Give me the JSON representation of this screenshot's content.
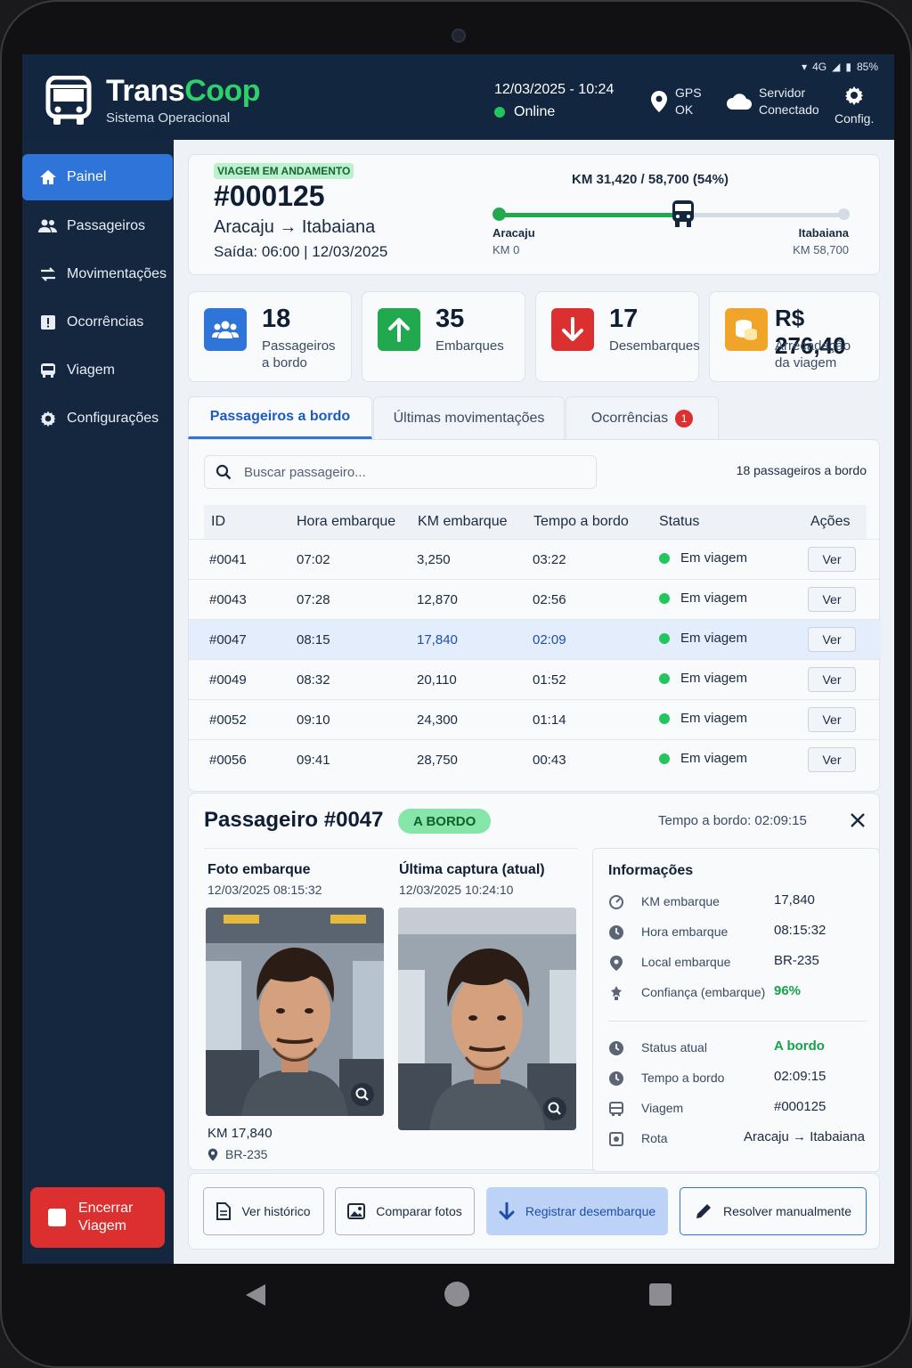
{
  "status_bar": {
    "network": "4G",
    "battery": "85%"
  },
  "app": {
    "brand_a": "Trans",
    "brand_b": "Coop",
    "subtitle": "Sistema Operacional"
  },
  "header": {
    "datetime": "12/03/2025 - 10:24",
    "connection": "Online",
    "gps_label": "GPS",
    "gps_status": "OK",
    "server_label": "Servidor",
    "server_status": "Conectado",
    "config_label": "Config."
  },
  "sidebar": {
    "items": [
      {
        "label": "Painel",
        "icon": "home-icon",
        "active": true
      },
      {
        "label": "Passageiros",
        "icon": "users-icon"
      },
      {
        "label": "Movimentações",
        "icon": "transfer-icon"
      },
      {
        "label": "Ocorrências",
        "icon": "alert-icon"
      },
      {
        "label": "Viagem",
        "icon": "bus-icon"
      },
      {
        "label": "Configurações",
        "icon": "gear-icon"
      }
    ],
    "end_trip": "Encerrar Viagem"
  },
  "trip": {
    "badge": "VIAGEM EM ANDAMENTO",
    "id": "#000125",
    "route": "Aracaju → Itabaiana",
    "departure": "Saída: 06:00  |  12/03/2025",
    "km_summary": "KM 31,420 / 58,700 (54%)",
    "progress": 0.54,
    "origin": "Aracaju",
    "origin_km": "KM 0",
    "destination": "Itabaiana",
    "destination_km": "KM 58,700"
  },
  "stats": [
    {
      "value": "18",
      "label1": "Passageiros",
      "label2": "a bordo",
      "color": "#2f74d8",
      "icon": "users-icon"
    },
    {
      "value": "35",
      "label1": "Embarques",
      "label2": "",
      "color": "#22a94f",
      "icon": "arrow-up-icon"
    },
    {
      "value": "17",
      "label1": "Desembarques",
      "label2": "",
      "color": "#dc2f2f",
      "icon": "arrow-down-icon"
    },
    {
      "value": "R$ 276,40",
      "label1": "Arrecadação",
      "label2": "da viagem",
      "color": "#f0a52a",
      "icon": "coins-icon"
    }
  ],
  "tabs": [
    {
      "label": "Passageiros a bordo",
      "active": true
    },
    {
      "label": "Últimas movimentações"
    },
    {
      "label": "Ocorrências",
      "badge": "1"
    }
  ],
  "table": {
    "search_placeholder": "Buscar passageiro...",
    "count": "18 passageiros a bordo",
    "headers": [
      "ID",
      "Hora embarque",
      "KM embarque",
      "Tempo a bordo",
      "Status",
      "Ações"
    ],
    "rows": [
      {
        "id": "#0041",
        "hora": "07:02",
        "km": "3,250",
        "tempo": "03:22",
        "status": "Em viagem",
        "acao": "Ver"
      },
      {
        "id": "#0043",
        "hora": "07:28",
        "km": "12,870",
        "tempo": "02:56",
        "status": "Em viagem",
        "acao": "Ver"
      },
      {
        "id": "#0047",
        "hora": "08:15",
        "km": "17,840",
        "tempo": "02:09",
        "status": "Em viagem",
        "acao": "Ver",
        "selected": true
      },
      {
        "id": "#0049",
        "hora": "08:32",
        "km": "20,110",
        "tempo": "01:52",
        "status": "Em viagem",
        "acao": "Ver"
      },
      {
        "id": "#0052",
        "hora": "09:10",
        "km": "24,300",
        "tempo": "01:14",
        "status": "Em viagem",
        "acao": "Ver"
      },
      {
        "id": "#0056",
        "hora": "09:41",
        "km": "28,750",
        "tempo": "00:43",
        "status": "Em viagem",
        "acao": "Ver"
      }
    ]
  },
  "detail": {
    "title": "Passageiro #0047",
    "badge": "A BORDO",
    "time_on_board": "Tempo a bordo: 02:09:15",
    "photo1_label": "Foto embarque",
    "photo1_ts": "12/03/2025 08:15:32",
    "photo2_label": "Última captura (atual)",
    "photo2_ts": "12/03/2025 10:24:10",
    "km_caption": "KM 17,840",
    "loc_caption": "BR-235",
    "info_title": "Informações",
    "info": [
      {
        "k": "KM embarque",
        "v": "17,840",
        "icon": "odometer-icon"
      },
      {
        "k": "Hora embarque",
        "v": "08:15:32",
        "icon": "clock-icon"
      },
      {
        "k": "Local embarque",
        "v": "BR-235",
        "icon": "pin-icon"
      },
      {
        "k": "Confiança (embarque)",
        "v": "96%",
        "icon": "badge-icon",
        "green": true
      }
    ],
    "info2": [
      {
        "k": "Status atual",
        "v": "A bordo",
        "icon": "clock-icon",
        "green": true
      },
      {
        "k": "Tempo a bordo",
        "v": "02:09:15",
        "icon": "clock-icon"
      },
      {
        "k": "Viagem",
        "v": "#000125",
        "icon": "bus-icon"
      },
      {
        "k": "Rota",
        "v": "Aracaju → Itabaiana",
        "icon": "route-icon"
      }
    ]
  },
  "actions": {
    "history": "Ver histórico",
    "compare": "Comparar fotos",
    "register": "Registrar desembarque",
    "resolve": "Resolver manualmente"
  }
}
